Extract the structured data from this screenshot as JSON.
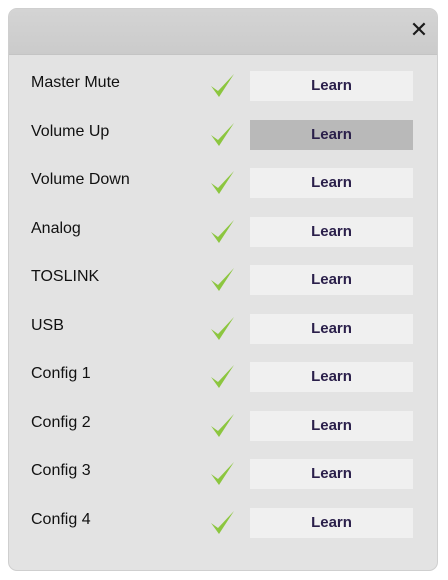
{
  "dialog": {
    "close_label": "✕"
  },
  "rows": [
    {
      "label": "Master Mute",
      "button": "Learn",
      "active": false
    },
    {
      "label": "Volume Up",
      "button": "Learn",
      "active": true
    },
    {
      "label": "Volume Down",
      "button": "Learn",
      "active": false
    },
    {
      "label": "Analog",
      "button": "Learn",
      "active": false
    },
    {
      "label": "TOSLINK",
      "button": "Learn",
      "active": false
    },
    {
      "label": "USB",
      "button": "Learn",
      "active": false
    },
    {
      "label": "Config 1",
      "button": "Learn",
      "active": false
    },
    {
      "label": "Config 2",
      "button": "Learn",
      "active": false
    },
    {
      "label": "Config 3",
      "button": "Learn",
      "active": false
    },
    {
      "label": "Config 4",
      "button": "Learn",
      "active": false
    }
  ],
  "icons": {
    "close": "close-icon",
    "status": "checkmark-icon"
  },
  "colors": {
    "check": "#8cc63f",
    "learn_active": "#b9b9b9",
    "learn_default": "#f0f0f0",
    "learn_text": "#2a1f4a"
  }
}
